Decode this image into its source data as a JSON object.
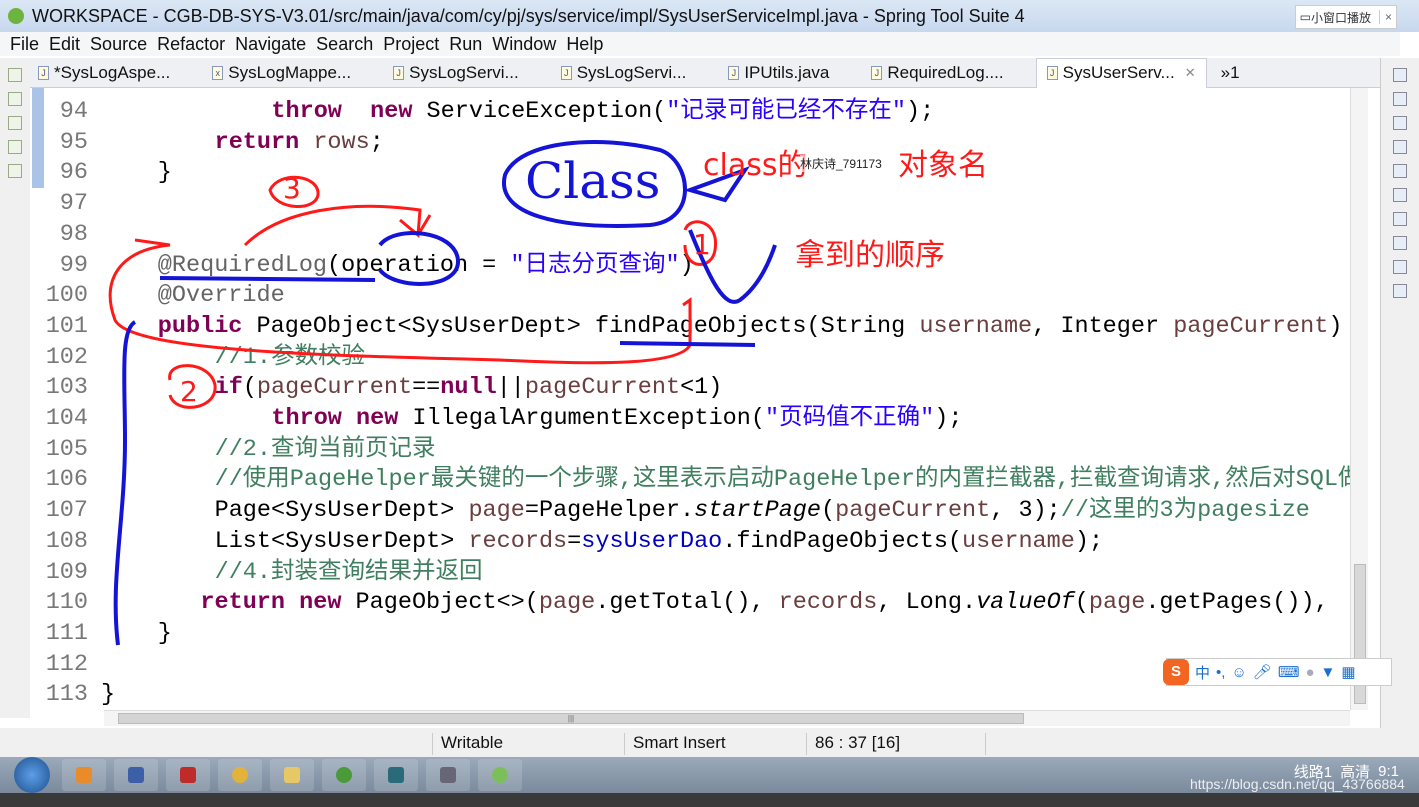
{
  "window": {
    "title": "WORKSPACE - CGB-DB-SYS-V3.01/src/main/java/com/cy/pj/sys/service/impl/SysUserServiceImpl.java - Spring Tool Suite 4",
    "pip_label": "小窗口播放",
    "pip_close": "×"
  },
  "menu": [
    "File",
    "Edit",
    "Source",
    "Refactor",
    "Navigate",
    "Search",
    "Project",
    "Run",
    "Window",
    "Help"
  ],
  "tabs": [
    {
      "label": "*SysLogAspe...",
      "icon": "java-file-icon"
    },
    {
      "label": "SysLogMappe...",
      "icon": "xml-file-icon"
    },
    {
      "label": "SysLogServi...",
      "icon": "java-file-icon"
    },
    {
      "label": "SysLogServi...",
      "icon": "java-file-icon"
    },
    {
      "label": "IPUtils.java",
      "icon": "java-file-icon"
    },
    {
      "label": "RequiredLog....",
      "icon": "java-file-icon"
    },
    {
      "label": "SysUserServ...",
      "icon": "java-file-icon",
      "active": true
    }
  ],
  "tab_overflow": "»1",
  "code": [
    {
      "n": "94",
      "indent": 12,
      "t": [
        [
          "kw",
          "throw"
        ],
        [
          "",
          "  "
        ],
        [
          "kw",
          "new"
        ],
        [
          "",
          " ServiceException("
        ],
        [
          "str",
          "\"记录可能已经不存在\""
        ],
        [
          "",
          ");"
        ]
      ]
    },
    {
      "n": "95",
      "indent": 8,
      "t": [
        [
          "kw",
          "return"
        ],
        [
          "",
          " "
        ],
        [
          "var",
          "rows"
        ],
        [
          "",
          ";"
        ]
      ]
    },
    {
      "n": "96",
      "indent": 4,
      "t": [
        [
          "",
          "}"
        ]
      ]
    },
    {
      "n": "97",
      "indent": 0,
      "t": []
    },
    {
      "n": "98",
      "indent": 0,
      "t": []
    },
    {
      "n": "99",
      "indent": 4,
      "t": [
        [
          "ann",
          "@RequiredLog"
        ],
        [
          "",
          "(operation = "
        ],
        [
          "str",
          "\"日志分页查询\""
        ],
        [
          "",
          ")"
        ]
      ]
    },
    {
      "n": "100",
      "indent": 4,
      "t": [
        [
          "ann",
          "@Override"
        ]
      ]
    },
    {
      "n": "101",
      "indent": 4,
      "t": [
        [
          "kw",
          "public"
        ],
        [
          "",
          " PageObject<SysUserDept> findPageObjects(String "
        ],
        [
          "var",
          "username"
        ],
        [
          "",
          ", Integer "
        ],
        [
          "var",
          "pageCurrent"
        ],
        [
          "",
          ")"
        ]
      ]
    },
    {
      "n": "102",
      "indent": 8,
      "t": [
        [
          "cm",
          "//1.参数校验"
        ]
      ]
    },
    {
      "n": "103",
      "indent": 8,
      "t": [
        [
          "kw",
          "if"
        ],
        [
          "",
          "("
        ],
        [
          "var",
          "pageCurrent"
        ],
        [
          "",
          "=="
        ],
        [
          "kw",
          "null"
        ],
        [
          "",
          "||"
        ],
        [
          "var",
          "pageCurrent"
        ],
        [
          "",
          "<1)"
        ]
      ]
    },
    {
      "n": "104",
      "indent": 12,
      "t": [
        [
          "kw",
          "throw"
        ],
        [
          "",
          " "
        ],
        [
          "kw",
          "new"
        ],
        [
          "",
          " IllegalArgumentException("
        ],
        [
          "str",
          "\"页码值不正确\""
        ],
        [
          "",
          ");"
        ]
      ]
    },
    {
      "n": "105",
      "indent": 8,
      "t": [
        [
          "cm",
          "//2.查询当前页记录"
        ]
      ]
    },
    {
      "n": "106",
      "indent": 8,
      "t": [
        [
          "cm",
          "//使用PageHelper最关键的一个步骤,这里表示启动PageHelper的内置拦截器,拦截查询请求,然后对SQL做处理."
        ]
      ]
    },
    {
      "n": "107",
      "indent": 8,
      "t": [
        [
          "",
          "Page<SysUserDept> "
        ],
        [
          "var",
          "page"
        ],
        [
          "",
          "=PageHelper."
        ],
        [
          "it",
          "startPage"
        ],
        [
          "",
          "("
        ],
        [
          "var",
          "pageCurrent"
        ],
        [
          "",
          ", 3);"
        ],
        [
          "cm",
          "//这里的3为pagesize"
        ]
      ]
    },
    {
      "n": "108",
      "indent": 8,
      "t": [
        [
          "",
          "List<SysUserDept> "
        ],
        [
          "var",
          "records"
        ],
        [
          "",
          "="
        ],
        [
          "fld",
          "sysUserDao"
        ],
        [
          "",
          ".findPageObjects("
        ],
        [
          "var",
          "username"
        ],
        [
          "",
          ");"
        ]
      ]
    },
    {
      "n": "109",
      "indent": 8,
      "t": [
        [
          "cm",
          "//4.封装查询结果并返回"
        ]
      ]
    },
    {
      "n": "110",
      "indent": 7,
      "t": [
        [
          "kw",
          "return"
        ],
        [
          "",
          " "
        ],
        [
          "kw",
          "new"
        ],
        [
          "",
          " PageObject<>("
        ],
        [
          "var",
          "page"
        ],
        [
          "",
          ".getTotal(), "
        ],
        [
          "var",
          "records"
        ],
        [
          "",
          ", Long."
        ],
        [
          "it",
          "valueOf"
        ],
        [
          "",
          "("
        ],
        [
          "var",
          "page"
        ],
        [
          "",
          ".getPages()),"
        ]
      ]
    },
    {
      "n": "111",
      "indent": 4,
      "t": [
        [
          "",
          "}"
        ]
      ]
    },
    {
      "n": "112",
      "indent": 0,
      "t": []
    },
    {
      "n": "113",
      "indent": 0,
      "t": [
        [
          "",
          "}"
        ]
      ]
    }
  ],
  "annotations": {
    "class_word": "Class",
    "note_class": "class的",
    "note_object": "对象名",
    "note_order": "拿到的顺序",
    "username_overlay": "林庆诗_791173",
    "num1": "1",
    "num2": "2",
    "num3": "3"
  },
  "status": {
    "writable": "Writable",
    "insert": "Smart Insert",
    "position": "86 : 37 [16]"
  },
  "ime": {
    "logo": "S",
    "mode": "中",
    "punct": "•,"
  },
  "tray": {
    "line": "线路1",
    "quality": "高清",
    "time": "9:1"
  },
  "watermark": "https://blog.csdn.net/qq_43766884",
  "colors": {
    "keyword": "#7f0055",
    "string": "#2a00ff",
    "comment": "#3f7f5f",
    "annotation_red": "#ff1a1a",
    "annotation_blue": "#1414d6"
  }
}
